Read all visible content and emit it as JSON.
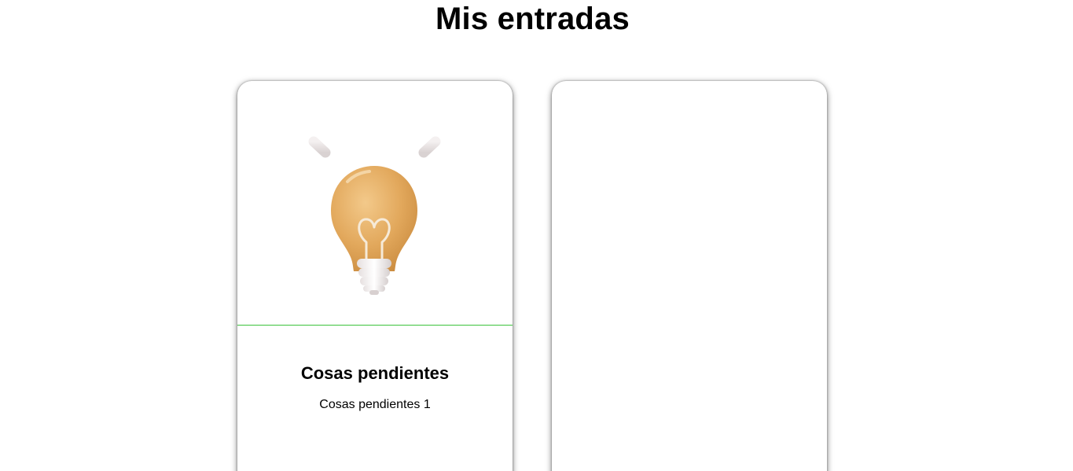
{
  "page": {
    "title": "Mis entradas"
  },
  "entries": [
    {
      "title": "Cosas pendientes",
      "description": "Cosas pendientes 1",
      "icon": "lightbulb-icon"
    }
  ],
  "add_card": {
    "icon": "plus-icon"
  },
  "colors": {
    "divider": "#3cc23c",
    "plus_top": "#26c8ea",
    "plus_bottom": "#129fe0",
    "bulb": "#e0a558"
  }
}
